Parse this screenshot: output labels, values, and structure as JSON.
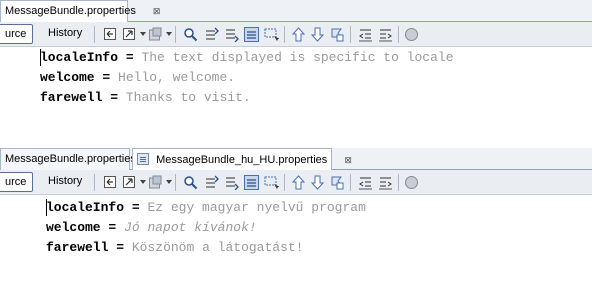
{
  "panel1": {
    "tabs": [
      {
        "label": "MessageBundle.properties",
        "close": "⊠"
      }
    ],
    "toolbar": {
      "source_label": "urce",
      "history_label": "History"
    },
    "lines": [
      {
        "key": "localeInfo",
        "eq": "=",
        "value": "The text displayed is specific to locale"
      },
      {
        "key": "welcome",
        "eq": "=",
        "value": "Hello, welcome."
      },
      {
        "key": "farewell",
        "eq": "=",
        "value": "Thanks to visit."
      }
    ]
  },
  "panel2": {
    "tabs": [
      {
        "label": "MessageBundle.properties",
        "close": "⊠"
      },
      {
        "label": "MessageBundle_hu_HU.properties",
        "close": "⊠"
      }
    ],
    "toolbar": {
      "source_label": "urce",
      "history_label": "History"
    },
    "lines": [
      {
        "key": "localeInfo",
        "eq": "=",
        "value": "Ez egy magyar nyelvű program"
      },
      {
        "key": "welcome",
        "eq": "=",
        "value": "Jó napot kívánok!"
      },
      {
        "key": "farewell",
        "eq": "=",
        "value": "Köszönöm a látogatást!"
      }
    ]
  },
  "icons": [
    "back-icon",
    "forward-history-icon",
    "last-edit-icon",
    "find-icon",
    "find-previous-icon",
    "find-next-icon",
    "toggle-highlight-icon",
    "rectangular-select-icon",
    "shift-up-icon",
    "shift-down-icon",
    "toggle-bookmark-icon",
    "shift-left-icon",
    "shift-right-icon",
    "record-macro-icon"
  ],
  "colors": {
    "value_text": "#9a9a9a",
    "tab_border": "#8da2c8",
    "toolbar_bg": "#eaedf2"
  }
}
